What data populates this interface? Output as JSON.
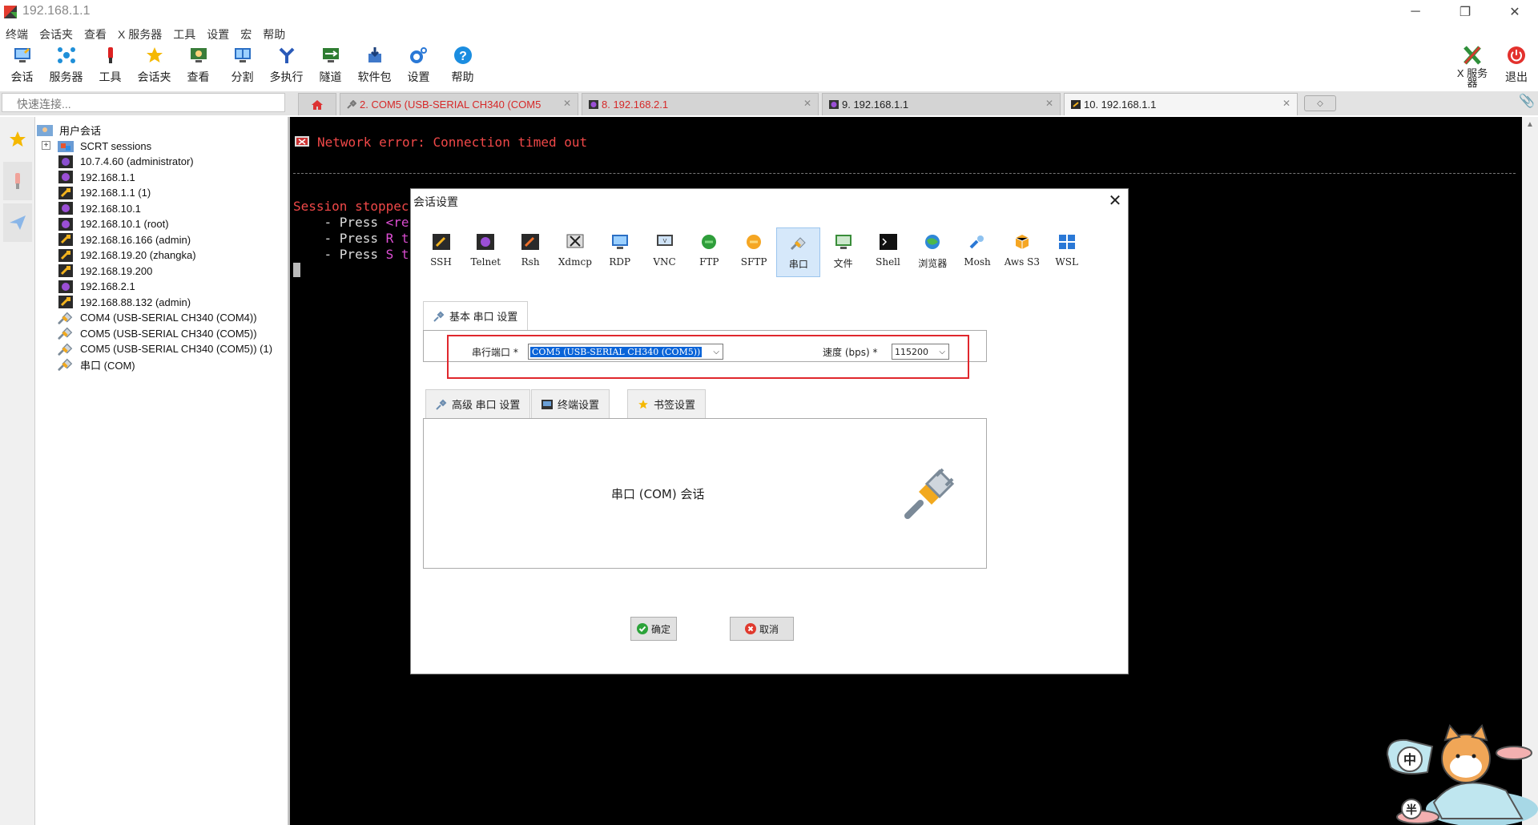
{
  "window": {
    "title": "192.168.1.1",
    "min": "─",
    "max": "❐",
    "close": "✕"
  },
  "menu": [
    "终端",
    "会话夹",
    "查看",
    "X 服务器",
    "工具",
    "设置",
    "宏",
    "帮助"
  ],
  "toolbar": {
    "left": [
      {
        "name": "session",
        "label": "会话",
        "icon": "session-icon"
      },
      {
        "name": "servers",
        "label": "服务器",
        "icon": "servers-icon"
      },
      {
        "name": "tools",
        "label": "工具",
        "icon": "tools-icon"
      },
      {
        "name": "sessions-folder",
        "label": "会话夹",
        "icon": "star-icon"
      },
      {
        "name": "view",
        "label": "查看",
        "icon": "view-icon"
      },
      {
        "name": "split",
        "label": "分割",
        "icon": "split-icon"
      },
      {
        "name": "multiexec",
        "label": "多执行",
        "icon": "multiexec-icon"
      },
      {
        "name": "tunneling",
        "label": "隧道",
        "icon": "tunnel-icon"
      },
      {
        "name": "packages",
        "label": "软件包",
        "icon": "packages-icon"
      },
      {
        "name": "settings",
        "label": "设置",
        "icon": "gear-icon"
      },
      {
        "name": "help",
        "label": "帮助",
        "icon": "help-icon"
      }
    ],
    "xserver": "X 服务器",
    "exit": "退出"
  },
  "quick_connect": {
    "placeholder": "快速连接..."
  },
  "tabs": [
    {
      "label": "2. COM5  (USB-SERIAL CH340 (COM5",
      "color": "#d62828"
    },
    {
      "label": "8. 192.168.2.1",
      "color": "#d62828"
    },
    {
      "label": "9. 192.168.1.1",
      "color": "#222"
    },
    {
      "label": "10. 192.168.1.1",
      "color": "#222"
    }
  ],
  "tree": {
    "root": "用户会话",
    "items": [
      {
        "label": "SCRT sessions",
        "icon": "folder-icon"
      },
      {
        "label": "10.7.4.60 (administrator)",
        "icon": "rdp-icon"
      },
      {
        "label": "192.168.1.1",
        "icon": "telnet-icon"
      },
      {
        "label": "192.168.1.1 (1)",
        "icon": "ssh-icon"
      },
      {
        "label": "192.168.10.1",
        "icon": "telnet-icon"
      },
      {
        "label": "192.168.10.1 (root)",
        "icon": "telnet-icon"
      },
      {
        "label": "192.168.16.166 (admin)",
        "icon": "ssh-icon"
      },
      {
        "label": "192.168.19.20 (zhangka)",
        "icon": "ssh-icon"
      },
      {
        "label": "192.168.19.200",
        "icon": "ssh-icon"
      },
      {
        "label": "192.168.2.1",
        "icon": "telnet-icon"
      },
      {
        "label": "192.168.88.132 (admin)",
        "icon": "ssh-icon"
      },
      {
        "label": "COM4  (USB-SERIAL CH340 (COM4))",
        "icon": "serial-icon"
      },
      {
        "label": "COM5  (USB-SERIAL CH340 (COM5))",
        "icon": "serial-icon"
      },
      {
        "label": "COM5  (USB-SERIAL CH340 (COM5)) (1)",
        "icon": "serial-icon"
      },
      {
        "label": "串口 (COM)",
        "icon": "serial-icon"
      }
    ]
  },
  "terminal": {
    "error": "Network error: Connection timed out",
    "stopped": "Session stoppec",
    "press1_a": "    - Press ",
    "press1_b": "<re",
    "press2_a": "    - Press ",
    "press2_b": "R t",
    "press3_a": "    - Press ",
    "press3_b": "S t"
  },
  "dialog": {
    "title": "会话设置",
    "types": [
      "SSH",
      "Telnet",
      "Rsh",
      "Xdmcp",
      "RDP",
      "VNC",
      "FTP",
      "SFTP",
      "串口",
      "文件",
      "Shell",
      "浏览器",
      "Mosh",
      "Aws S3",
      "WSL"
    ],
    "selected_type": "串口",
    "basic_tab": "基本 串口 设置",
    "port_label": "串行端口 *",
    "port_value": "COM5  (USB-SERIAL CH340 (COM5))",
    "speed_label": "速度 (bps) *",
    "speed_value": "115200",
    "adv_tabs": [
      "高级 串口 设置",
      "终端设置",
      "书签设置"
    ],
    "description": "串口 (COM) 会话",
    "ok": "确定",
    "cancel": "取消"
  },
  "mascot": {
    "badge1": "中",
    "badge2": "半"
  }
}
